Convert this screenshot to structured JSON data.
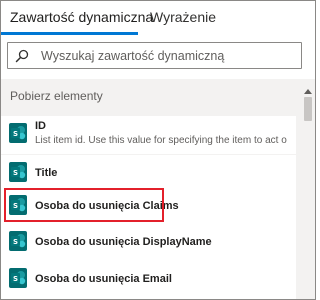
{
  "tabs": [
    {
      "label": "Zawartość dynamiczna",
      "active": true
    },
    {
      "label": "Wyrażenie",
      "active": false
    }
  ],
  "search": {
    "placeholder": "Wyszukaj zawartość dynamiczną",
    "value": ""
  },
  "section": {
    "header": "Pobierz elementy"
  },
  "items": [
    {
      "title": "ID",
      "description": "List item id. Use this value for specifying the item to act o",
      "icon": "sharepoint-icon"
    },
    {
      "title": "Title",
      "description": "",
      "icon": "sharepoint-icon"
    },
    {
      "title": "Osoba do usunięcia Claims",
      "description": "",
      "icon": "sharepoint-icon",
      "highlighted": true
    },
    {
      "title": "Osoba do usunięcia DisplayName",
      "description": "",
      "icon": "sharepoint-icon"
    },
    {
      "title": "Osoba do usunięcia Email",
      "description": "",
      "icon": "sharepoint-icon"
    }
  ],
  "colors": {
    "accent": "#0078d4",
    "highlight": "#e3202b",
    "sharepoint": "#036c70",
    "panel_bg": "#f3f2f1"
  }
}
